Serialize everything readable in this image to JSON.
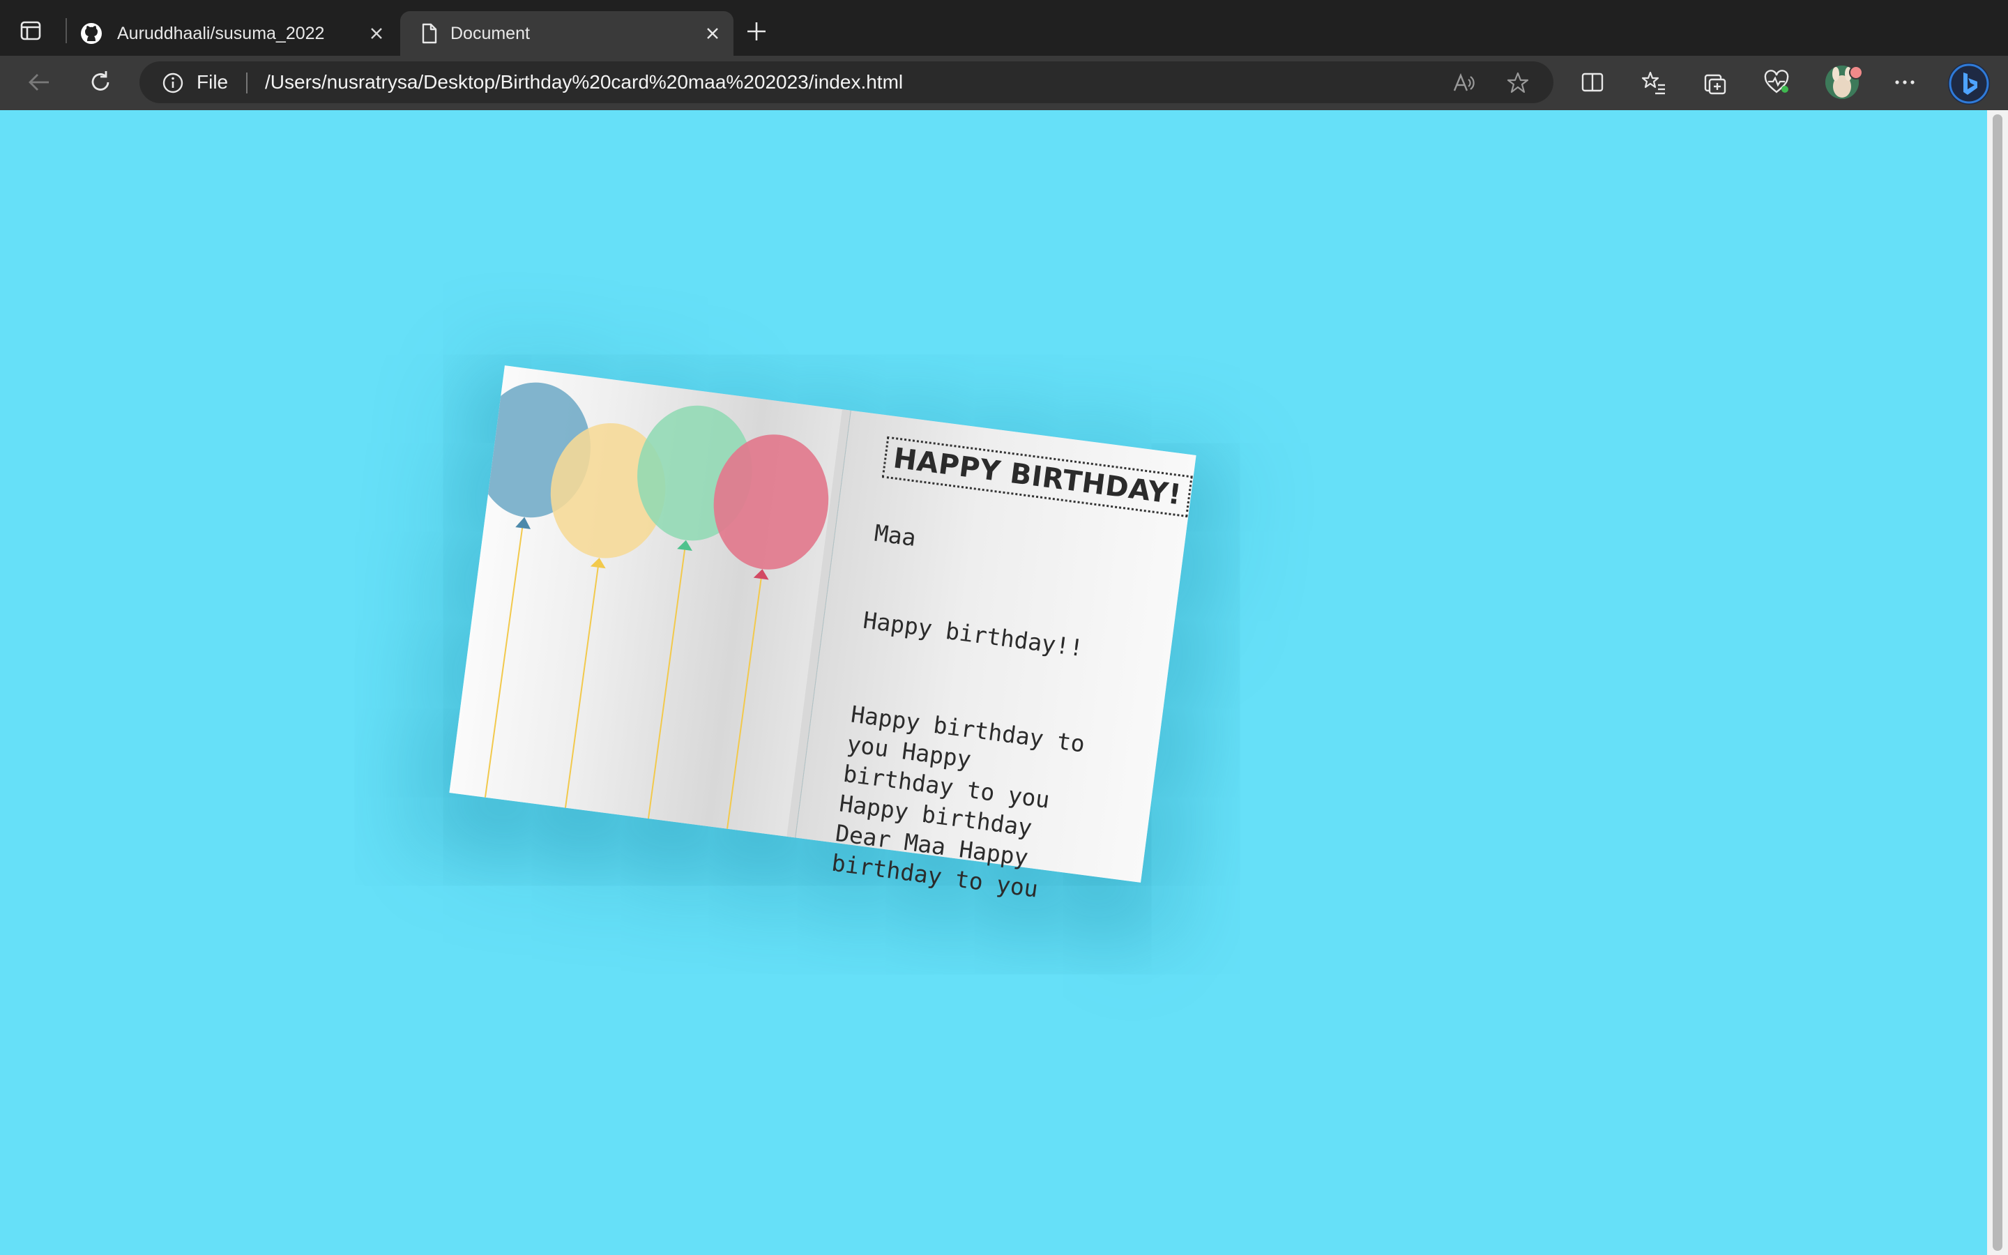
{
  "browser": {
    "tabs": [
      {
        "title": "Auruddhaali/susuma_2022",
        "icon": "github-icon",
        "active": false
      },
      {
        "title": "Document",
        "icon": "document-icon",
        "active": true
      }
    ],
    "address": {
      "scheme_label": "File",
      "url": "/Users/nusratrysa/Desktop/Birthday%20card%20maa%202023/index.html"
    },
    "accent_color": "#2f7bd9"
  },
  "page": {
    "background_color": "#66e0f8",
    "card": {
      "heading": "HAPPY BIRTHDAY!",
      "name": "Maa",
      "wish": "Happy birthday!!",
      "song": "Happy birthday to you Happy birthday to you Happy birthday Dear Maa Happy birthday to you",
      "balloon_colors": [
        "#76aec9",
        "#f6da96",
        "#8ed9b3",
        "#e27a8d"
      ]
    }
  }
}
